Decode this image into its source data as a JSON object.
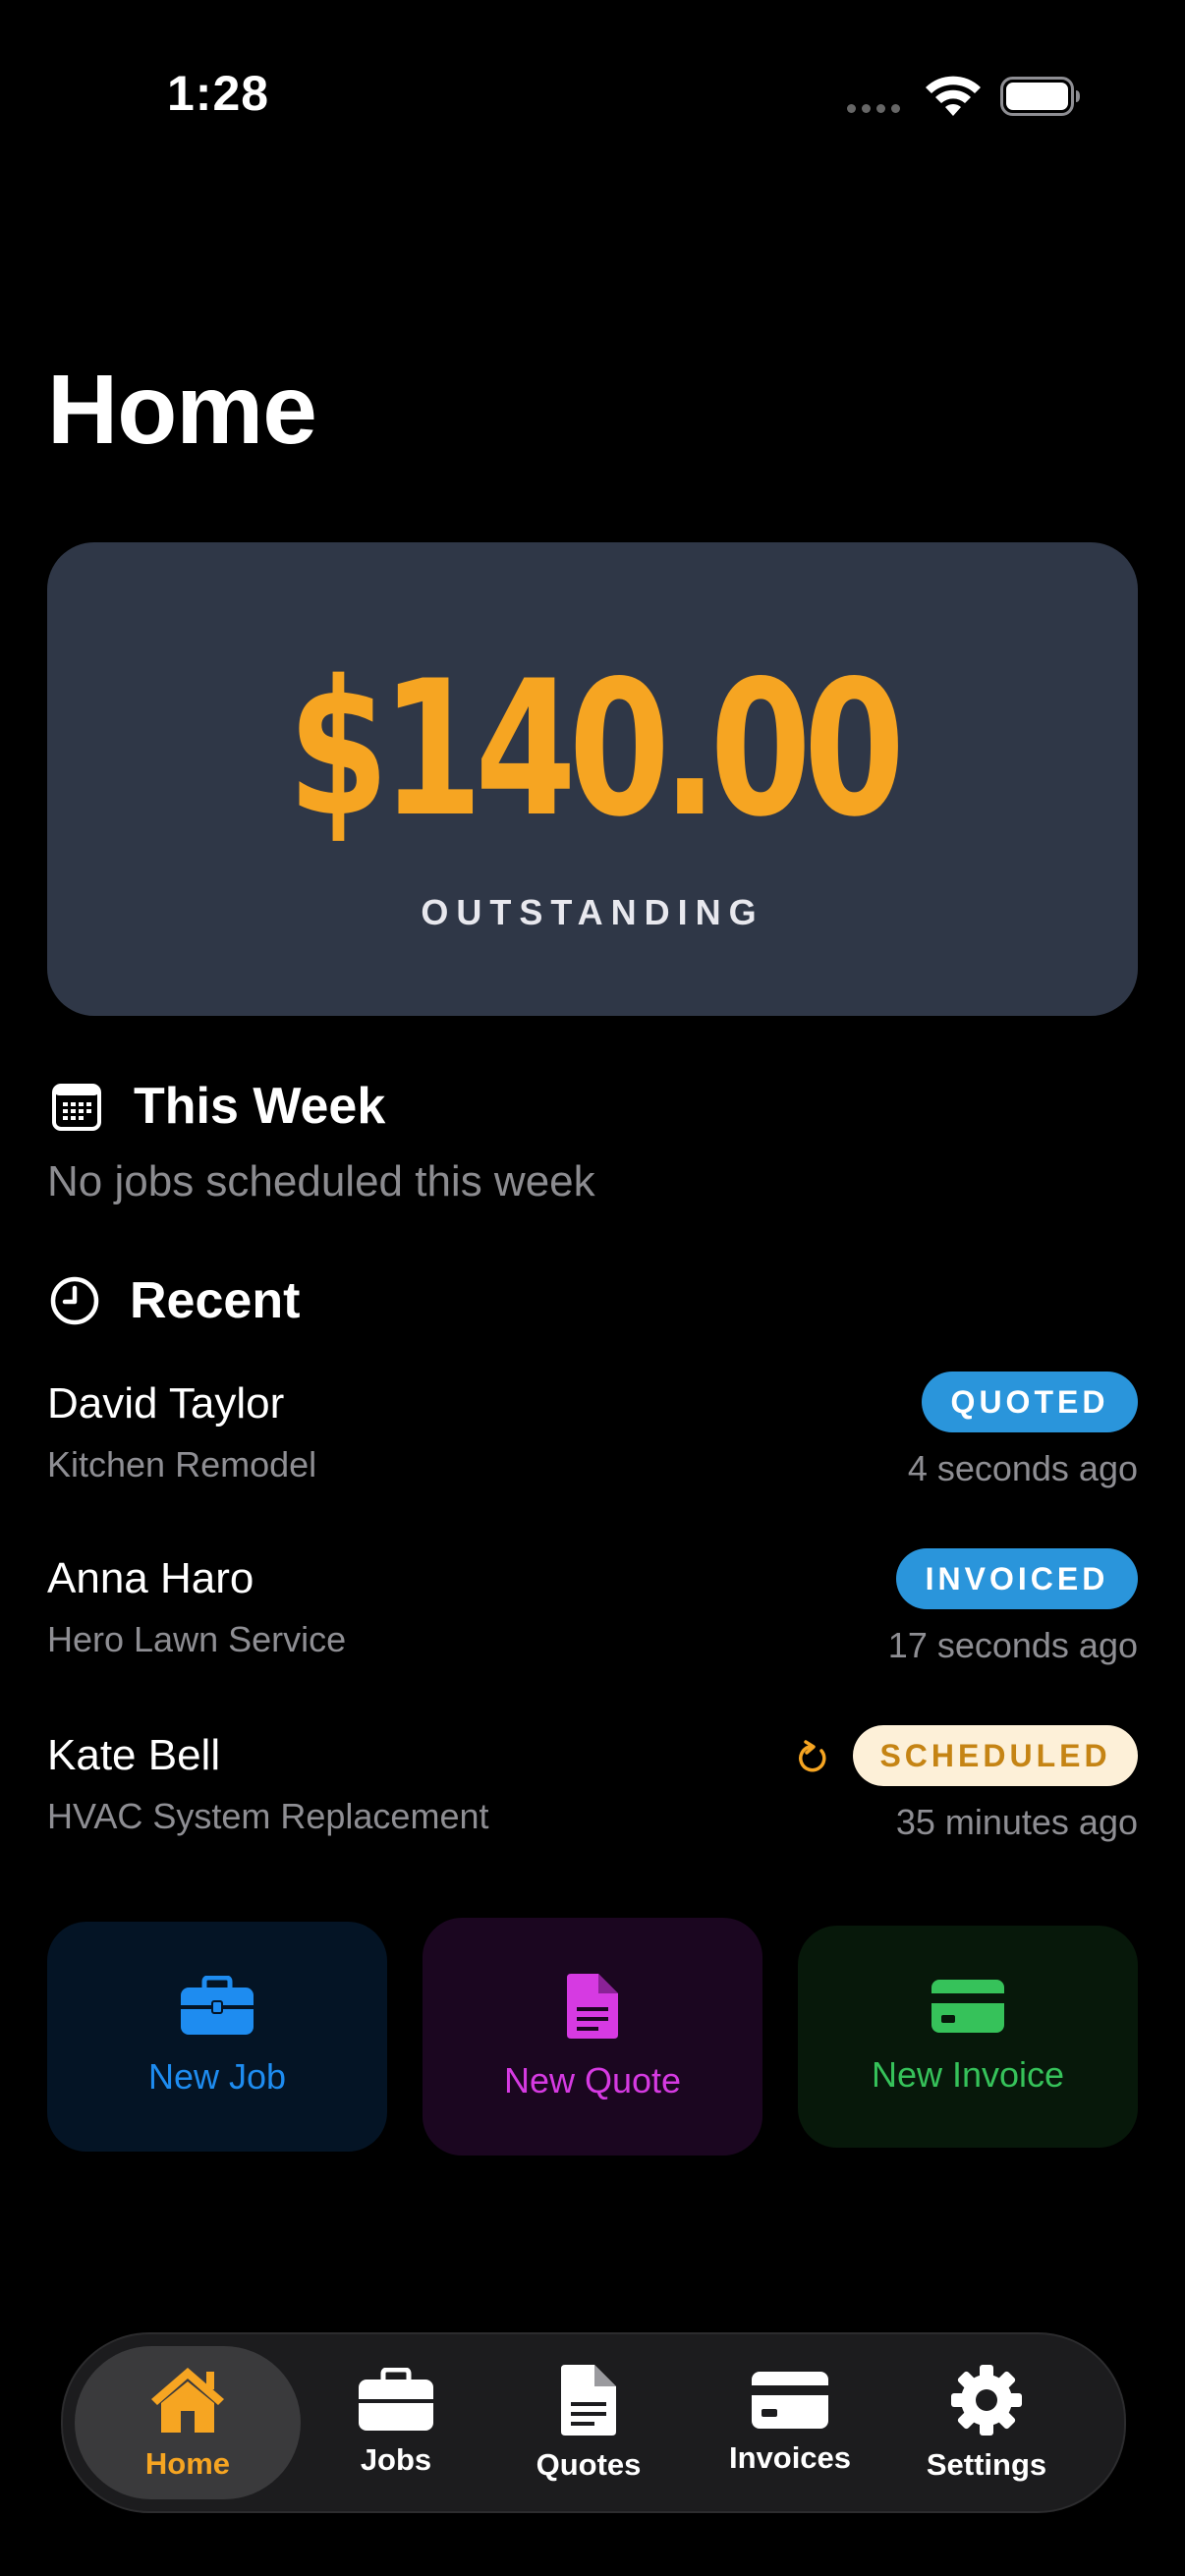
{
  "status_bar": {
    "time": "1:28"
  },
  "page": {
    "title": "Home"
  },
  "outstanding": {
    "amount": "$140.00",
    "label": "OUTSTANDING"
  },
  "this_week": {
    "title": "This Week",
    "empty_text": "No jobs scheduled this week"
  },
  "recent": {
    "title": "Recent",
    "items": [
      {
        "name": "David Taylor",
        "job": "Kitchen Remodel",
        "status": "QUOTED",
        "time": "4 seconds ago"
      },
      {
        "name": "Anna Haro",
        "job": "Hero Lawn Service",
        "status": "INVOICED",
        "time": "17 seconds ago"
      },
      {
        "name": "Kate Bell",
        "job": "HVAC System Replacement",
        "status": "SCHEDULED",
        "time": "35 minutes ago"
      }
    ]
  },
  "actions": {
    "new_job": "New Job",
    "new_quote": "New Quote",
    "new_invoice": "New Invoice"
  },
  "tabs": [
    {
      "label": "Home",
      "icon": "house-icon"
    },
    {
      "label": "Jobs",
      "icon": "briefcase-icon"
    },
    {
      "label": "Quotes",
      "icon": "document-icon"
    },
    {
      "label": "Invoices",
      "icon": "card-icon"
    },
    {
      "label": "Settings",
      "icon": "gear-icon"
    }
  ],
  "colors": {
    "accent": "#f6a522",
    "quoted": "#2a95db",
    "invoiced": "#2a95db",
    "scheduled_bg": "#fdf0d8",
    "scheduled_text": "#c58414",
    "job": "#1e8cf0",
    "quote": "#d63ae2",
    "invoice": "#36c25a"
  }
}
